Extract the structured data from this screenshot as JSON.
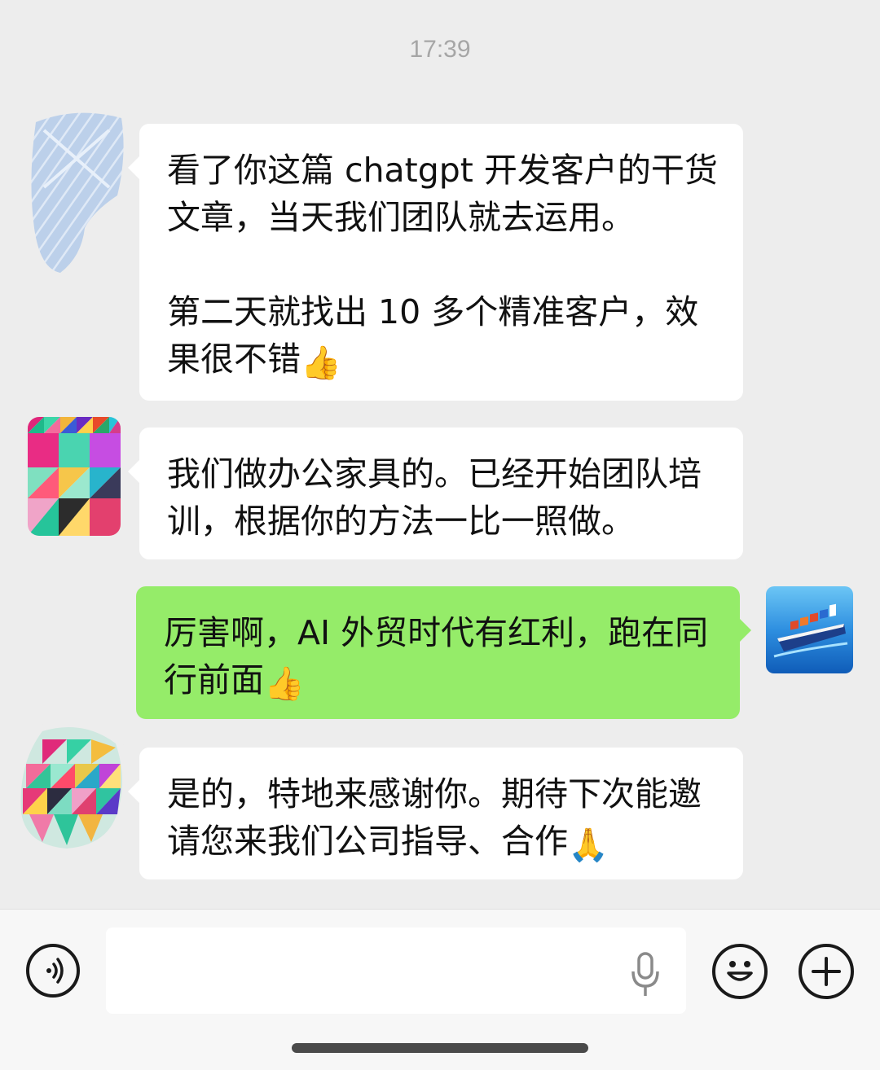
{
  "timestamp": "17:39",
  "messages": [
    {
      "sender": "contact",
      "text": "看了你这篇 chatgpt 开发客户的干货文章，当天我们团队就去运用。\n\n第二天就找出 10 多个精准客户，效果很不错",
      "emoji": "👍"
    },
    {
      "sender": "contact",
      "text": "我们做办公家具的。已经开始团队培训，根据你的方法一比一照做。",
      "emoji": ""
    },
    {
      "sender": "me",
      "text": "厉害啊，AI 外贸时代有红利，跑在同行前面",
      "emoji": "👍"
    },
    {
      "sender": "contact",
      "text": "是的，特地来感谢你。期待下次能邀请您来我们公司指导、合作",
      "emoji": "🙏"
    }
  ],
  "input_bar": {
    "voice_icon": "voice-mode-icon",
    "mic_icon": "microphone-icon",
    "emoji_icon": "emoji-smile-icon",
    "plus_icon": "plus-icon"
  },
  "colors": {
    "background": "#ededed",
    "incoming_bubble": "#ffffff",
    "outgoing_bubble": "#95ec69",
    "timestamp": "#a6a6a6"
  }
}
